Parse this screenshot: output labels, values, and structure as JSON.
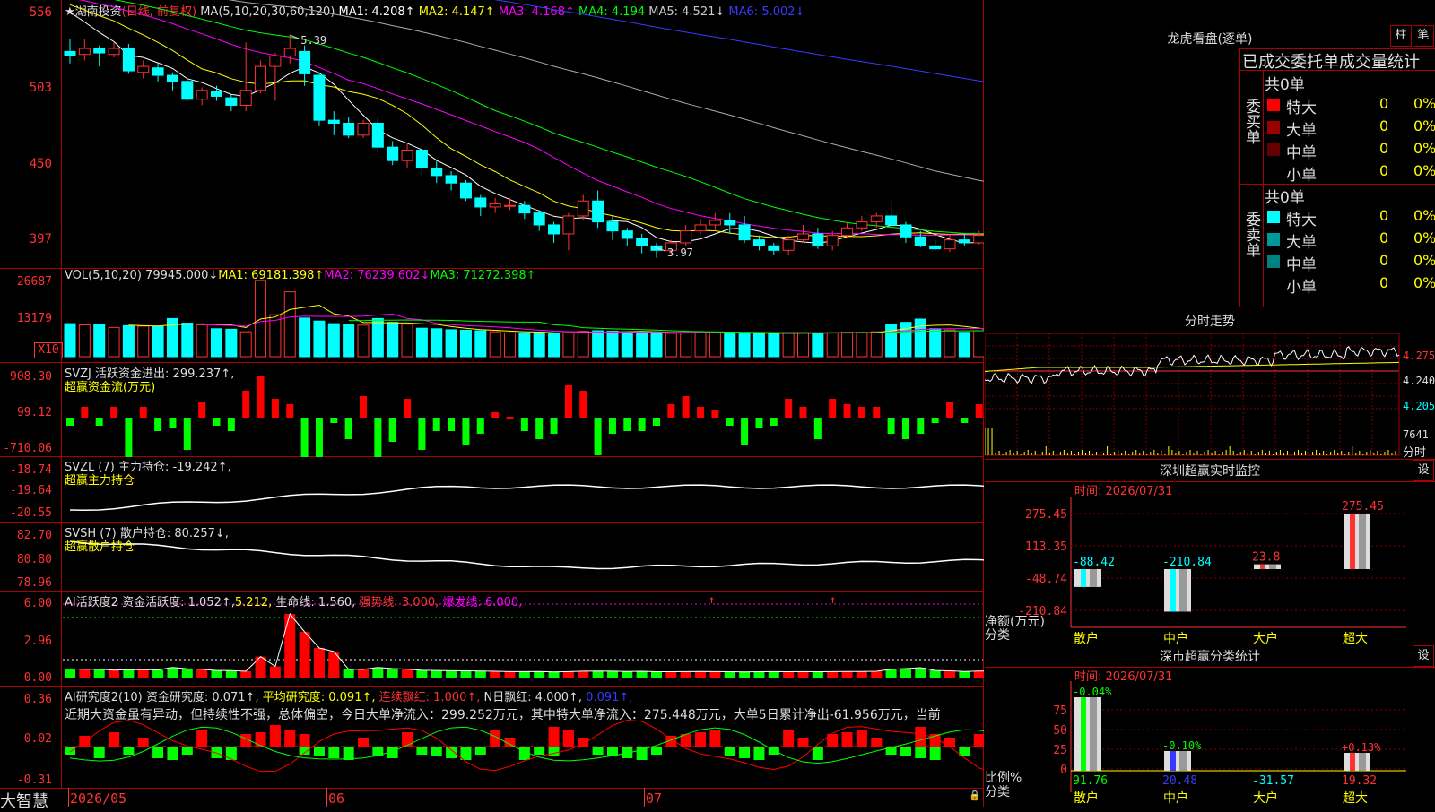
{
  "main_chart": {
    "star": "★",
    "stock_name": "湖南投资",
    "period": "(日线, 前复权)",
    "ma_label": "MA(5,10,20,30,60,120)",
    "ma1": "MA1: 4.208↑",
    "ma2": "MA2: 4.147↑",
    "ma3": "MA3: 4.168↑",
    "ma4": "MA4: 4.194",
    "ma5": "MA5: 4.521↓",
    "ma6": "MA6: 5.002↓",
    "y_ticks": [
      "556",
      "503",
      "450",
      "397"
    ],
    "high_label": "5.39",
    "low_label": "3.97"
  },
  "vol_panel": {
    "title": "VOL(5,10,20)",
    "value": "79945.000↓",
    "ma1": "MA1: 69181.398↑",
    "ma2": "MA2: 76239.602↓",
    "ma3": "MA3: 71272.398↑",
    "y_ticks": [
      "26687",
      "13179"
    ],
    "unit": "X10"
  },
  "svzj_panel": {
    "title": "SVZJ",
    "name": "活跃资金进出: 299.237↑,",
    "subtitle": "超赢资金流(万元)",
    "y_ticks": [
      "908.30",
      "99.12",
      "-710.06"
    ]
  },
  "svzl_panel": {
    "title": "SVZL (7)",
    "name": "主力持仓: -19.242↑,",
    "subtitle": "超赢主力持仓",
    "y_ticks": [
      "-18.74",
      "-19.64",
      "-20.55"
    ]
  },
  "svsh_panel": {
    "title": "SVSH (7)",
    "name": "散户持仓: 80.257↓,",
    "subtitle": "超赢散户持仓",
    "y_ticks": [
      "82.70",
      "80.80",
      "78.96"
    ]
  },
  "ai_active_panel": {
    "title": "AI活跃度2",
    "v1": "资金活跃度: 1.052↑,",
    "v2": "5.212,",
    "v3": "生命线: 1.560,",
    "v4": "强势线: 3.000,",
    "v5": "爆发线: 6.000,",
    "y_ticks": [
      "6.00",
      "2.96",
      "0.00"
    ]
  },
  "ai_research_panel": {
    "title": "AI研究度2(10)",
    "v1": "资金研究度: 0.071↑,",
    "v2": "平均研究度: 0.091↑,",
    "v3": "连续飘红: 1.000↑,",
    "v4": "N日飘红: 4.000↑,",
    "v5": "0.091↑,",
    "comment": "近期大资金虽有异动，但持续性不强，总体偏空，今日大单净流入：299.252万元，其中特大单净流入：275.448万元，大单5日累计净出-61.956万元，当前",
    "y_ticks": [
      "0.36",
      "0.02",
      "-0.31"
    ]
  },
  "bottom_bar": {
    "brand": "大智慧",
    "dates": [
      "2026/05",
      "06",
      "07"
    ]
  },
  "dragon_tiger": {
    "title": "龙虎看盘(逐单)",
    "btn_bar": "柱",
    "btn_pen": "笔",
    "header": "已成交委托单成交量统计",
    "buy_label": "委买单",
    "sell_label": "委卖单",
    "buy_total": "共0单",
    "sell_total": "共0单",
    "buy_rows": [
      {
        "name": "特大",
        "count": "0",
        "pct": "0%",
        "color": "#ff0000"
      },
      {
        "name": "大单",
        "count": "0",
        "pct": "0%",
        "color": "#990000"
      },
      {
        "name": "中单",
        "count": "0",
        "pct": "0%",
        "color": "#660000"
      },
      {
        "name": "小单",
        "count": "0",
        "pct": "0%",
        "color": "#000000"
      }
    ],
    "sell_rows": [
      {
        "name": "特大",
        "count": "0",
        "pct": "0%",
        "color": "#00ffff"
      },
      {
        "name": "大单",
        "count": "0",
        "pct": "0%",
        "color": "#009999"
      },
      {
        "name": "中单",
        "count": "0",
        "pct": "0%",
        "color": "#008080"
      },
      {
        "name": "小单",
        "count": "0",
        "pct": "0%",
        "color": "#000000"
      }
    ]
  },
  "intraday": {
    "title": "分时走势",
    "y_ticks": [
      "4.275",
      "4.240",
      "4.205"
    ],
    "vol_label": "7641",
    "unit_label": "分时"
  },
  "sz_monitor": {
    "title": "深圳超赢实时监控",
    "btn": "设",
    "time": "时间: 2026/07/31",
    "y_ticks": [
      "275.45",
      "113.35",
      "-48.74",
      "-210.84"
    ],
    "y_unit1": "净额(万元)",
    "y_unit2": "分类",
    "categories": [
      "散户",
      "中户",
      "大户",
      "超大"
    ],
    "values": [
      "-88.42",
      "-210.84",
      "23.8",
      "275.45"
    ]
  },
  "sz_stats": {
    "title": "深市超赢分类统计",
    "btn": "设",
    "time": "时间: 2026/07/31",
    "y_ticks": [
      "75",
      "50",
      "25",
      "0"
    ],
    "y_unit1": "比例%",
    "y_unit2": "分类",
    "categories": [
      "散户",
      "中户",
      "大户",
      "超大"
    ],
    "top_values": [
      "-0.04%",
      "-0.10%",
      "",
      "+0.13%"
    ],
    "bottom_values": [
      "91.76",
      "20.48",
      "-31.57",
      "19.32"
    ]
  },
  "chart_data": {
    "type": "candlestick",
    "title": "湖南投资 (日线, 前复权)",
    "ylim": [
      3.85,
      5.6
    ],
    "x_ticks": [
      "2026/05",
      "06",
      "07"
    ],
    "high_annotation": 5.39,
    "low_annotation": 3.97,
    "candles": [
      [
        5.28,
        5.25,
        5.36,
        5.2
      ],
      [
        5.26,
        5.3,
        5.36,
        5.22
      ],
      [
        5.3,
        5.27,
        5.32,
        5.18
      ],
      [
        5.26,
        5.3,
        5.34,
        5.24
      ],
      [
        5.3,
        5.15,
        5.33,
        5.13
      ],
      [
        5.14,
        5.18,
        5.22,
        5.1
      ],
      [
        5.17,
        5.12,
        5.2,
        5.08
      ],
      [
        5.12,
        5.08,
        5.14,
        5.02
      ],
      [
        5.08,
        4.96,
        5.1,
        4.95
      ],
      [
        4.96,
        5.02,
        5.04,
        4.92
      ],
      [
        5.01,
        4.98,
        5.05,
        4.95
      ],
      [
        4.97,
        4.92,
        4.99,
        4.88
      ],
      [
        4.92,
        5.02,
        5.34,
        4.88
      ],
      [
        5.02,
        5.18,
        5.22,
        5.0
      ],
      [
        5.18,
        5.25,
        5.27,
        4.95
      ],
      [
        5.25,
        5.3,
        5.39,
        5.2
      ],
      [
        5.28,
        5.13,
        5.32,
        5.05
      ],
      [
        5.12,
        4.82,
        5.14,
        4.78
      ],
      [
        4.82,
        4.8,
        4.88,
        4.72
      ],
      [
        4.8,
        4.72,
        4.84,
        4.7
      ],
      [
        4.72,
        4.8,
        4.82,
        4.7
      ],
      [
        4.8,
        4.64,
        4.84,
        4.6
      ],
      [
        4.64,
        4.55,
        4.68,
        4.52
      ],
      [
        4.55,
        4.62,
        4.66,
        4.5
      ],
      [
        4.62,
        4.5,
        4.65,
        4.45
      ],
      [
        4.5,
        4.45,
        4.55,
        4.4
      ],
      [
        4.45,
        4.4,
        4.48,
        4.35
      ],
      [
        4.4,
        4.3,
        4.42,
        4.28
      ],
      [
        4.3,
        4.24,
        4.32,
        4.18
      ],
      [
        4.24,
        4.26,
        4.3,
        4.2
      ],
      [
        4.25,
        4.25,
        4.3,
        4.22
      ],
      [
        4.25,
        4.2,
        4.28,
        4.16
      ],
      [
        4.2,
        4.12,
        4.22,
        4.08
      ],
      [
        4.12,
        4.06,
        4.14,
        4.0
      ],
      [
        4.06,
        4.18,
        4.2,
        3.95
      ],
      [
        4.18,
        4.28,
        4.32,
        4.15
      ],
      [
        4.28,
        4.14,
        4.35,
        4.1
      ],
      [
        4.14,
        4.08,
        4.18,
        4.02
      ],
      [
        4.08,
        4.03,
        4.1,
        3.98
      ],
      [
        4.03,
        3.98,
        4.06,
        3.93
      ],
      [
        3.98,
        3.95,
        4.0,
        3.9
      ],
      [
        3.95,
        4.0,
        4.02,
        3.92
      ],
      [
        4.0,
        4.08,
        4.12,
        3.98
      ],
      [
        4.08,
        4.12,
        4.16,
        4.06
      ],
      [
        4.12,
        4.15,
        4.2,
        4.08
      ],
      [
        4.15,
        4.12,
        4.2,
        4.06
      ],
      [
        4.12,
        4.02,
        4.18,
        4.0
      ],
      [
        4.02,
        3.98,
        4.05,
        3.95
      ],
      [
        3.98,
        3.95,
        4.0,
        3.92
      ],
      [
        3.95,
        4.02,
        4.05,
        3.92
      ],
      [
        4.02,
        4.06,
        4.12,
        4.0
      ],
      [
        4.06,
        3.98,
        4.1,
        3.96
      ],
      [
        3.98,
        4.05,
        4.08,
        3.95
      ],
      [
        4.05,
        4.1,
        4.14,
        4.03
      ],
      [
        4.1,
        4.14,
        4.18,
        4.08
      ],
      [
        4.14,
        4.18,
        4.2,
        4.1
      ],
      [
        4.18,
        4.12,
        4.28,
        4.08
      ],
      [
        4.12,
        4.04,
        4.14,
        4.0
      ],
      [
        4.04,
        3.98,
        4.08,
        3.97
      ],
      [
        3.98,
        3.96,
        4.02,
        3.95
      ],
      [
        3.96,
        4.02,
        4.05,
        3.94
      ],
      [
        4.02,
        4.0,
        4.06,
        3.98
      ],
      [
        4.0,
        4.05,
        4.08,
        3.99
      ],
      [
        4.05,
        4.08,
        4.1,
        4.03
      ],
      [
        4.08,
        4.12,
        4.14,
        4.06
      ],
      [
        4.12,
        4.18,
        4.22,
        4.1
      ],
      [
        4.18,
        4.22,
        4.24,
        4.15
      ]
    ],
    "vol_units": "X10",
    "volume": [
      13000,
      12500,
      12800,
      11500,
      12200,
      12000,
      11800,
      15000,
      13200,
      12500,
      11000,
      10800,
      9800,
      30000,
      16500,
      25500,
      15200,
      14000,
      13000,
      12500,
      12400,
      15000,
      13500,
      12800,
      11200,
      11000,
      10600,
      10400,
      10200,
      9800,
      9400,
      9400,
      9600,
      9000,
      9400,
      10000,
      10200,
      10000,
      9600,
      9800,
      9200,
      9200,
      9400,
      9600,
      9400,
      9200,
      9000,
      9200,
      9400,
      9200,
      9400,
      9200,
      9400,
      9600,
      9600,
      9800,
      12500,
      13500,
      14800,
      11000,
      10500,
      9600,
      10200,
      9800,
      9500,
      10400,
      12000
    ]
  }
}
